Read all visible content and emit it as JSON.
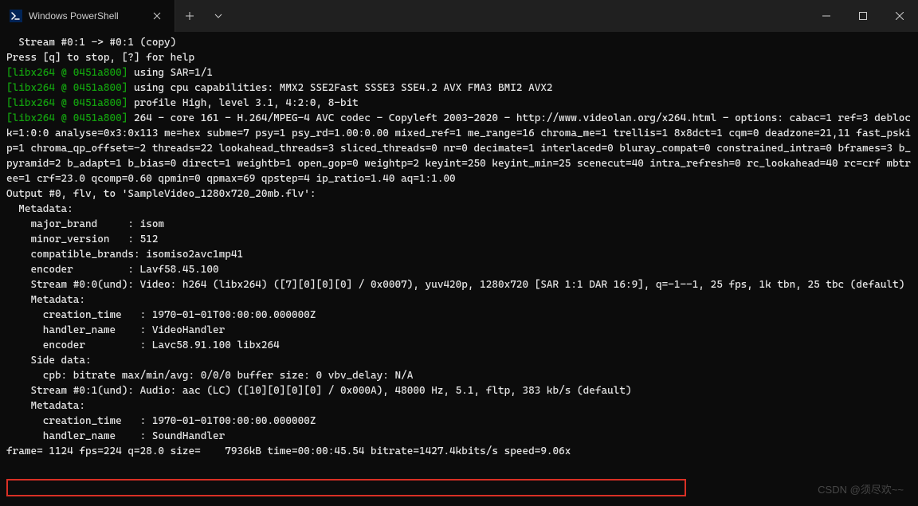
{
  "tab": {
    "title": "Windows PowerShell"
  },
  "lines": {
    "l0": "  Stream #0:1 -> #0:1 (copy)",
    "l1": "Press [q] to stop, [?] for help",
    "p0": "[libx264 @ 0451a800]",
    "p0b": " using SAR=1/1",
    "p1": "[libx264 @ 0451a800]",
    "p1b": " using cpu capabilities: MMX2 SSE2Fast SSSE3 SSE4.2 AVX FMA3 BMI2 AVX2",
    "p2": "[libx264 @ 0451a800]",
    "p2b": " profile High, level 3.1, 4:2:0, 8-bit",
    "p3": "[libx264 @ 0451a800]",
    "p3b": " 264 - core 161 - H.264/MPEG-4 AVC codec - Copyleft 2003-2020 - http://www.videolan.org/x264.html - options: cabac=1 ref=3 deblock=1:0:0 analyse=0x3:0x113 me=hex subme=7 psy=1 psy_rd=1.00:0.00 mixed_ref=1 me_range=16 chroma_me=1 trellis=1 8x8dct=1 cqm=0 deadzone=21,11 fast_pskip=1 chroma_qp_offset=-2 threads=22 lookahead_threads=3 sliced_threads=0 nr=0 decimate=1 interlaced=0 bluray_compat=0 constrained_intra=0 bframes=3 b_pyramid=2 b_adapt=1 b_bias=0 direct=1 weightb=1 open_gop=0 weightp=2 keyint=250 keyint_min=25 scenecut=40 intra_refresh=0 rc_lookahead=40 rc=crf mbtree=1 crf=23.0 qcomp=0.60 qpmin=0 qpmax=69 qpstep=4 ip_ratio=1.40 aq=1:1.00",
    "l2": "Output #0, flv, to 'SampleVideo_1280x720_20mb.flv':",
    "l3": "  Metadata:",
    "l4": "    major_brand     : isom",
    "l5": "    minor_version   : 512",
    "l6": "    compatible_brands: isomiso2avc1mp41",
    "l7": "    encoder         : Lavf58.45.100",
    "l8": "    Stream #0:0(und): Video: h264 (libx264) ([7][0][0][0] / 0x0007), yuv420p, 1280x720 [SAR 1:1 DAR 16:9], q=-1--1, 25 fps, 1k tbn, 25 tbc (default)",
    "l9": "    Metadata:",
    "l10": "      creation_time   : 1970-01-01T00:00:00.000000Z",
    "l11": "      handler_name    : VideoHandler",
    "l12": "      encoder         : Lavc58.91.100 libx264",
    "l13": "    Side data:",
    "l14": "      cpb: bitrate max/min/avg: 0/0/0 buffer size: 0 vbv_delay: N/A",
    "l15": "    Stream #0:1(und): Audio: aac (LC) ([10][0][0][0] / 0x000A), 48000 Hz, 5.1, fltp, 383 kb/s (default)",
    "l16": "    Metadata:",
    "l17": "      creation_time   : 1970-01-01T00:00:00.000000Z",
    "l18": "      handler_name    : SoundHandler",
    "lprog": "frame= 1124 fps=224 q=28.0 size=    7936kB time=00:00:45.54 bitrate=1427.4kbits/s speed=9.06x"
  },
  "watermark": "CSDN @须尽欢~~"
}
